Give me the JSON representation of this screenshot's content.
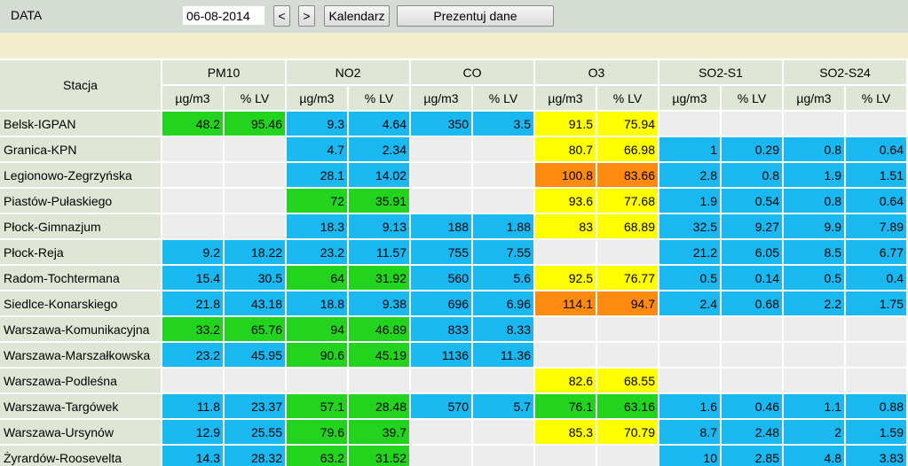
{
  "toolbar": {
    "label": "DATA",
    "date_value": "06-08-2014",
    "prev_label": "<",
    "next_label": ">",
    "calendar_label": "Kalendarz",
    "show_label": "Prezentuj dane"
  },
  "table": {
    "station_header": "Stacja",
    "groups": [
      "PM10",
      "NO2",
      "CO",
      "O3",
      "SO2-S1",
      "SO2-S24"
    ],
    "units": [
      "µg/m3",
      "% LV",
      "µg/m3",
      "% LV",
      "µg/m3",
      "% LV",
      "µg/m3",
      "% LV",
      "µg/m3",
      "% LV",
      "µg/m3",
      "% LV"
    ],
    "rows": [
      {
        "station": "Belsk-IGPAN",
        "values": [
          "48.2",
          "95.46",
          "9.3",
          "4.64",
          "350",
          "3.5",
          "91.5",
          "75.94",
          "",
          "",
          "",
          ""
        ],
        "colors": [
          "green",
          "green",
          "blue",
          "blue",
          "blue",
          "blue",
          "yellow",
          "yellow",
          "empty",
          "empty",
          "empty",
          "empty"
        ]
      },
      {
        "station": "Granica-KPN",
        "values": [
          "",
          "",
          "4.7",
          "2.34",
          "",
          "",
          "80.7",
          "66.98",
          "1",
          "0.29",
          "0.8",
          "0.64"
        ],
        "colors": [
          "empty",
          "empty",
          "blue",
          "blue",
          "empty",
          "empty",
          "yellow",
          "yellow",
          "blue",
          "blue",
          "blue",
          "blue"
        ]
      },
      {
        "station": "Legionowo-Zegrzyńska",
        "values": [
          "",
          "",
          "28.1",
          "14.02",
          "",
          "",
          "100.8",
          "83.66",
          "2.8",
          "0.8",
          "1.9",
          "1.51"
        ],
        "colors": [
          "empty",
          "empty",
          "blue",
          "blue",
          "empty",
          "empty",
          "orange",
          "orange",
          "blue",
          "blue",
          "blue",
          "blue"
        ]
      },
      {
        "station": "Piastów-Pułaskiego",
        "values": [
          "",
          "",
          "72",
          "35.91",
          "",
          "",
          "93.6",
          "77.68",
          "1.9",
          "0.54",
          "0.8",
          "0.64"
        ],
        "colors": [
          "empty",
          "empty",
          "green",
          "green",
          "empty",
          "empty",
          "yellow",
          "yellow",
          "blue",
          "blue",
          "blue",
          "blue"
        ]
      },
      {
        "station": "Płock-Gimnazjum",
        "values": [
          "",
          "",
          "18.3",
          "9.13",
          "188",
          "1.88",
          "83",
          "68.89",
          "32.5",
          "9.27",
          "9.9",
          "7.89"
        ],
        "colors": [
          "empty",
          "empty",
          "blue",
          "blue",
          "blue",
          "blue",
          "yellow",
          "yellow",
          "blue",
          "blue",
          "blue",
          "blue"
        ]
      },
      {
        "station": "Płock-Reja",
        "values": [
          "9.2",
          "18.22",
          "23.2",
          "11.57",
          "755",
          "7.55",
          "",
          "",
          "21.2",
          "6.05",
          "8.5",
          "6.77"
        ],
        "colors": [
          "blue",
          "blue",
          "blue",
          "blue",
          "blue",
          "blue",
          "empty",
          "empty",
          "blue",
          "blue",
          "blue",
          "blue"
        ]
      },
      {
        "station": "Radom-Tochtermana",
        "values": [
          "15.4",
          "30.5",
          "64",
          "31.92",
          "560",
          "5.6",
          "92.5",
          "76.77",
          "0.5",
          "0.14",
          "0.5",
          "0.4"
        ],
        "colors": [
          "blue",
          "blue",
          "green",
          "green",
          "blue",
          "blue",
          "yellow",
          "yellow",
          "blue",
          "blue",
          "blue",
          "blue"
        ]
      },
      {
        "station": "Siedlce-Konarskiego",
        "values": [
          "21.8",
          "43.18",
          "18.8",
          "9.38",
          "696",
          "6.96",
          "114.1",
          "94.7",
          "2.4",
          "0.68",
          "2.2",
          "1.75"
        ],
        "colors": [
          "blue",
          "blue",
          "blue",
          "blue",
          "blue",
          "blue",
          "orange",
          "orange",
          "blue",
          "blue",
          "blue",
          "blue"
        ]
      },
      {
        "station": "Warszawa-Komunikacyjna",
        "values": [
          "33.2",
          "65.76",
          "94",
          "46.89",
          "833",
          "8.33",
          "",
          "",
          "",
          "",
          "",
          ""
        ],
        "colors": [
          "green",
          "green",
          "green",
          "green",
          "blue",
          "blue",
          "empty",
          "empty",
          "empty",
          "empty",
          "empty",
          "empty"
        ]
      },
      {
        "station": "Warszawa-Marszałkowska",
        "values": [
          "23.2",
          "45.95",
          "90.6",
          "45.19",
          "1136",
          "11.36",
          "",
          "",
          "",
          "",
          "",
          ""
        ],
        "colors": [
          "blue",
          "blue",
          "green",
          "green",
          "blue",
          "blue",
          "empty",
          "empty",
          "empty",
          "empty",
          "empty",
          "empty"
        ]
      },
      {
        "station": "Warszawa-Podleśna",
        "values": [
          "",
          "",
          "",
          "",
          "",
          "",
          "82.6",
          "68.55",
          "",
          "",
          "",
          ""
        ],
        "colors": [
          "empty",
          "empty",
          "empty",
          "empty",
          "empty",
          "empty",
          "yellow",
          "yellow",
          "empty",
          "empty",
          "empty",
          "empty"
        ]
      },
      {
        "station": "Warszawa-Targówek",
        "values": [
          "11.8",
          "23.37",
          "57.1",
          "28.48",
          "570",
          "5.7",
          "76.1",
          "63.16",
          "1.6",
          "0.46",
          "1.1",
          "0.88"
        ],
        "colors": [
          "blue",
          "blue",
          "green",
          "green",
          "blue",
          "blue",
          "green",
          "green",
          "blue",
          "blue",
          "blue",
          "blue"
        ]
      },
      {
        "station": "Warszawa-Ursynów",
        "values": [
          "12.9",
          "25.55",
          "79.6",
          "39.7",
          "",
          "",
          "85.3",
          "70.79",
          "8.7",
          "2.48",
          "2",
          "1.59"
        ],
        "colors": [
          "blue",
          "blue",
          "green",
          "green",
          "empty",
          "empty",
          "yellow",
          "yellow",
          "blue",
          "blue",
          "blue",
          "blue"
        ]
      },
      {
        "station": "Żyrardów-Roosevelta",
        "values": [
          "14.3",
          "28.32",
          "63.2",
          "31.52",
          "",
          "",
          "",
          "",
          "10",
          "2.85",
          "4.8",
          "3.83"
        ],
        "colors": [
          "blue",
          "blue",
          "green",
          "green",
          "empty",
          "empty",
          "empty",
          "empty",
          "blue",
          "blue",
          "blue",
          "blue"
        ]
      }
    ]
  },
  "colors": {
    "blue": "#19b8f0",
    "green": "#22d41e",
    "yellow": "#ffff00",
    "orange": "#ff8a10",
    "empty": "#ededed",
    "header": "#dfe6d6",
    "toolbar": "#d4dcd4",
    "band": "#f2eecd"
  }
}
